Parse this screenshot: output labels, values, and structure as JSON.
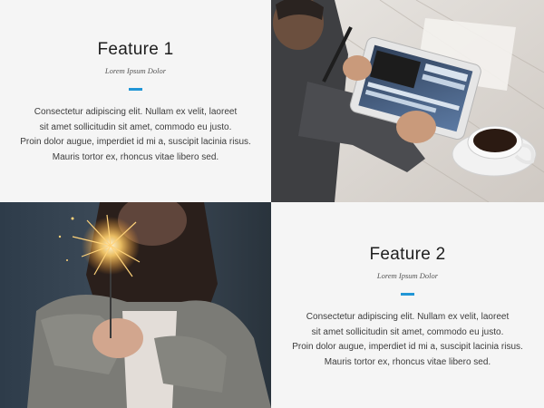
{
  "features": [
    {
      "title": "Feature 1",
      "subtitle": "Lorem Ipsum Dolor",
      "body_lines": [
        "Consectetur adipiscing elit. Nullam ex velit, laoreet",
        "sit amet sollicitudin sit amet, commodo eu justo.",
        "Proin dolor augue, imperdiet id mi a, suscipit lacinia risus.",
        "Mauris tortor ex, rhoncus vitae libero sed."
      ]
    },
    {
      "title": "Feature 2",
      "subtitle": "Lorem Ipsum Dolor",
      "body_lines": [
        "Consectetur adipiscing elit. Nullam ex velit, laoreet",
        "sit amet sollicitudin sit amet, commodo eu justo.",
        "Proin dolor augue, imperdiet id mi a, suscipit lacinia risus.",
        "Mauris tortor ex, rhoncus vitae libero sed."
      ]
    }
  ],
  "colors": {
    "accent": "#2196d6",
    "panel_background": "#f5f5f5"
  },
  "images": [
    {
      "name": "tablet-photo",
      "subject": "man using tablet with coffee cup"
    },
    {
      "name": "sparkler-photo",
      "subject": "woman holding lit sparkler"
    }
  ]
}
